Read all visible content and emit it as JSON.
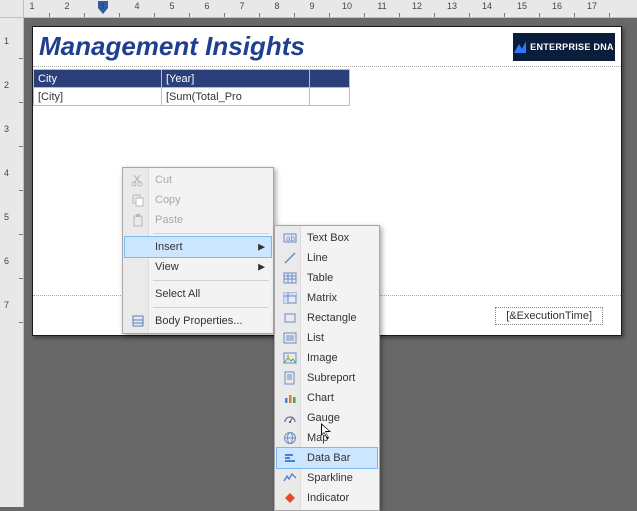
{
  "ruler_h": [
    "1",
    "2",
    "3",
    "4",
    "5",
    "6",
    "7",
    "8",
    "9",
    "10",
    "11",
    "12",
    "13",
    "14",
    "15",
    "16",
    "17"
  ],
  "ruler_v": [
    "1",
    "2",
    "3",
    "4",
    "5",
    "6",
    "7"
  ],
  "report": {
    "title": "Management Insights",
    "logo_text": "ENTERPRISE DNA",
    "table": {
      "headers": [
        "City",
        "[Year]",
        ""
      ],
      "row": [
        "[City]",
        "[Sum(Total_Pro",
        ""
      ]
    },
    "footer": "[&ExecutionTime]"
  },
  "context_menu": {
    "items": [
      {
        "label": "Cut",
        "disabled": true,
        "icon": "cut"
      },
      {
        "label": "Copy",
        "disabled": true,
        "icon": "copy"
      },
      {
        "label": "Paste",
        "disabled": true,
        "icon": "paste"
      },
      {
        "sep": true
      },
      {
        "label": "Insert",
        "submenu": true,
        "hover": true
      },
      {
        "label": "View",
        "submenu": true
      },
      {
        "sep": true
      },
      {
        "label": "Select All"
      },
      {
        "sep": true
      },
      {
        "label": "Body Properties...",
        "icon": "props"
      }
    ]
  },
  "insert_submenu": {
    "items": [
      {
        "label": "Text Box",
        "icon": "textbox"
      },
      {
        "label": "Line",
        "icon": "line"
      },
      {
        "label": "Table",
        "icon": "table"
      },
      {
        "label": "Matrix",
        "icon": "matrix"
      },
      {
        "label": "Rectangle",
        "icon": "rect"
      },
      {
        "label": "List",
        "icon": "list"
      },
      {
        "label": "Image",
        "icon": "image"
      },
      {
        "label": "Subreport",
        "icon": "subreport"
      },
      {
        "label": "Chart",
        "icon": "chart"
      },
      {
        "label": "Gauge",
        "icon": "gauge"
      },
      {
        "label": "Map",
        "icon": "map"
      },
      {
        "label": "Data Bar",
        "icon": "databar",
        "hover": true
      },
      {
        "label": "Sparkline",
        "icon": "sparkline"
      },
      {
        "label": "Indicator",
        "icon": "indicator"
      }
    ]
  }
}
